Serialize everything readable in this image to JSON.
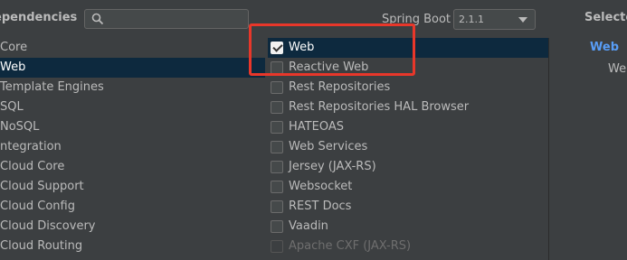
{
  "header": {
    "title": "ependencies",
    "spring_boot_label": "Spring Boot",
    "spring_boot_version": "2.1.1",
    "selected_title": "Selecte"
  },
  "categories": [
    {
      "label": "Core",
      "selected": false
    },
    {
      "label": "Web",
      "selected": true
    },
    {
      "label": "Template Engines",
      "selected": false
    },
    {
      "label": "SQL",
      "selected": false
    },
    {
      "label": "NoSQL",
      "selected": false
    },
    {
      "label": "ntegration",
      "selected": false
    },
    {
      "label": "Cloud Core",
      "selected": false
    },
    {
      "label": "Cloud Support",
      "selected": false
    },
    {
      "label": "Cloud Config",
      "selected": false
    },
    {
      "label": "Cloud Discovery",
      "selected": false
    },
    {
      "label": "Cloud Routing",
      "selected": false
    }
  ],
  "dependencies": [
    {
      "label": "Web",
      "checked": true,
      "selected": true,
      "disabled": false
    },
    {
      "label": "Reactive Web",
      "checked": false,
      "selected": false,
      "disabled": false
    },
    {
      "label": "Rest Repositories",
      "checked": false,
      "selected": false,
      "disabled": false
    },
    {
      "label": "Rest Repositories HAL Browser",
      "checked": false,
      "selected": false,
      "disabled": false
    },
    {
      "label": "HATEOAS",
      "checked": false,
      "selected": false,
      "disabled": false
    },
    {
      "label": "Web Services",
      "checked": false,
      "selected": false,
      "disabled": false
    },
    {
      "label": "Jersey (JAX-RS)",
      "checked": false,
      "selected": false,
      "disabled": false
    },
    {
      "label": "Websocket",
      "checked": false,
      "selected": false,
      "disabled": false
    },
    {
      "label": "REST Docs",
      "checked": false,
      "selected": false,
      "disabled": false
    },
    {
      "label": "Vaadin",
      "checked": false,
      "selected": false,
      "disabled": false
    },
    {
      "label": "Apache CXF (JAX-RS)",
      "checked": false,
      "selected": false,
      "disabled": true
    }
  ],
  "selected_panel": {
    "group": "Web",
    "item": "We"
  },
  "colors": {
    "background": "#3c3f41",
    "selection": "#0d293e",
    "accent_link": "#589df6",
    "annotation_red": "#e8372a"
  }
}
